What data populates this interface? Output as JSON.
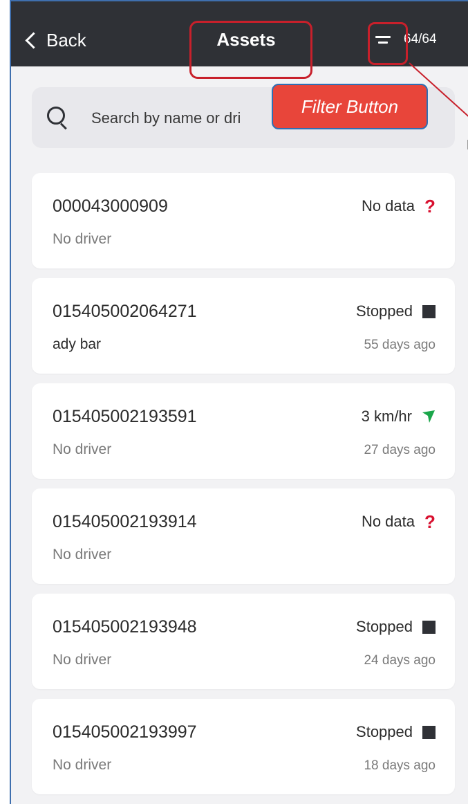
{
  "header": {
    "back_label": "Back",
    "title": "Assets",
    "count": "64/64"
  },
  "search": {
    "placeholder": "Search by name or dri"
  },
  "annotation": {
    "label": "Filter Button",
    "color": "#e8453a",
    "outline_color": "#c8202b"
  },
  "assets": [
    {
      "id": "000043000909",
      "driver": "No driver",
      "status": "No data",
      "status_icon": "question-icon",
      "time": ""
    },
    {
      "id": "015405002064271",
      "driver": "ady bar",
      "status": "Stopped",
      "status_icon": "stop-square-icon",
      "time": "55 days ago"
    },
    {
      "id": "015405002193591",
      "driver": "No driver",
      "status": "3 km/hr",
      "status_icon": "moving-arrow-icon",
      "time": "27 days ago"
    },
    {
      "id": "015405002193914",
      "driver": "No driver",
      "status": "No data",
      "status_icon": "question-icon",
      "time": ""
    },
    {
      "id": "015405002193948",
      "driver": "No driver",
      "status": "Stopped",
      "status_icon": "stop-square-icon",
      "time": "24 days ago"
    },
    {
      "id": "015405002193997",
      "driver": "No driver",
      "status": "Stopped",
      "status_icon": "stop-square-icon",
      "time": "18 days ago"
    }
  ],
  "colors": {
    "header_bg": "#2f3136",
    "no_data": "#d8102f",
    "moving": "#1aa64a",
    "stopped": "#2f3136"
  }
}
